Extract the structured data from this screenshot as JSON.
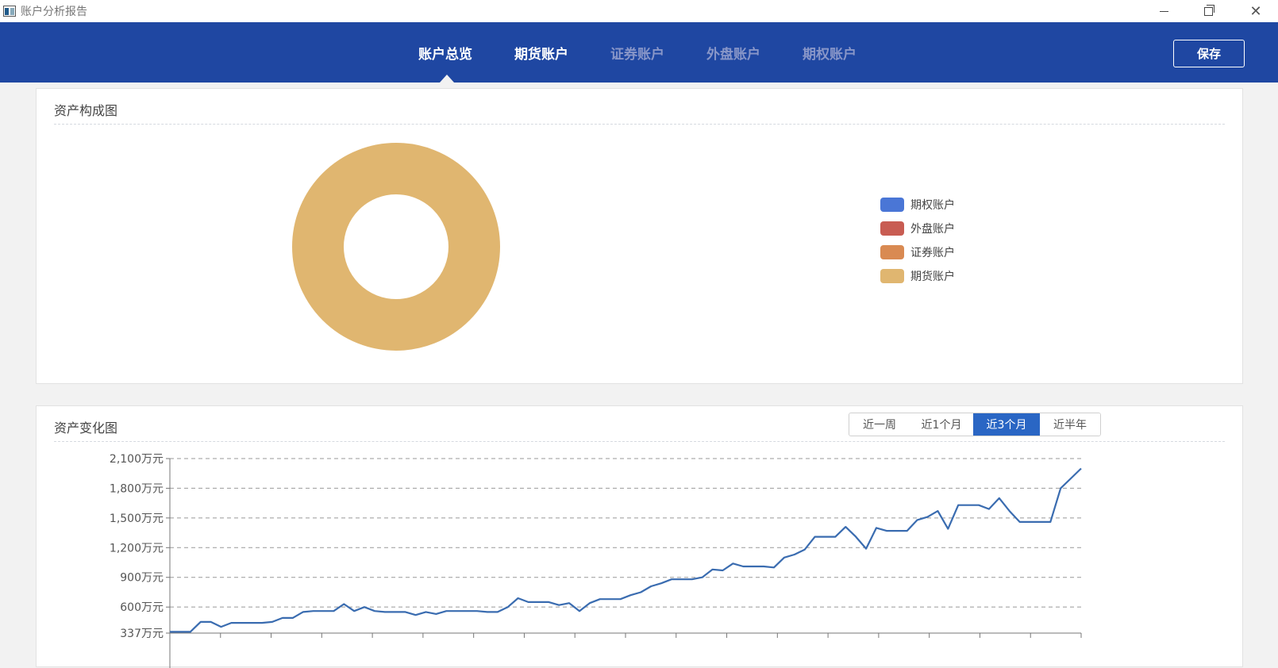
{
  "window": {
    "title": "账户分析报告"
  },
  "nav": {
    "tabs": [
      {
        "label": "账户总览",
        "active": true
      },
      {
        "label": "期货账户",
        "active": false
      },
      {
        "label": "证券账户",
        "active": false
      },
      {
        "label": "外盘账户",
        "active": false
      },
      {
        "label": "期权账户",
        "active": false
      }
    ],
    "save_label": "保存"
  },
  "composition": {
    "title": "资产构成图",
    "legend": [
      {
        "label": "期权账户",
        "color": "#4a76d6"
      },
      {
        "label": "外盘账户",
        "color": "#c85c52"
      },
      {
        "label": "证券账户",
        "color": "#d98a52"
      },
      {
        "label": "期货账户",
        "color": "#e0b670"
      }
    ]
  },
  "change": {
    "title": "资产变化图",
    "ranges": [
      {
        "label": "近一周",
        "active": false
      },
      {
        "label": "近1个月",
        "active": false
      },
      {
        "label": "近3个月",
        "active": true
      },
      {
        "label": "近半年",
        "active": false
      }
    ]
  },
  "chart_data": [
    {
      "type": "pie",
      "title": "资产构成图",
      "categories": [
        "期权账户",
        "外盘账户",
        "证券账户",
        "期货账户"
      ],
      "values": [
        0,
        0,
        0,
        100
      ],
      "colors": [
        "#4a76d6",
        "#c85c52",
        "#d98a52",
        "#e0b670"
      ],
      "legend": "right"
    },
    {
      "type": "line",
      "title": "资产变化图",
      "y_ticks": [
        "337万元",
        "600万元",
        "900万元",
        "1,200万元",
        "1,500万元",
        "1,800万元",
        "2,100万元"
      ],
      "ylim": [
        337,
        2100
      ],
      "grid": true,
      "series": [
        {
          "color": "#3a6cb0",
          "values": [
            350,
            350,
            350,
            450,
            450,
            400,
            440,
            440,
            440,
            440,
            450,
            490,
            490,
            550,
            560,
            560,
            560,
            630,
            560,
            600,
            560,
            550,
            550,
            550,
            520,
            550,
            530,
            560,
            560,
            560,
            560,
            550,
            550,
            600,
            690,
            650,
            650,
            650,
            620,
            640,
            560,
            640,
            680,
            680,
            680,
            720,
            750,
            810,
            840,
            880,
            880,
            880,
            900,
            980,
            970,
            1040,
            1010,
            1010,
            1010,
            1000,
            1100,
            1130,
            1180,
            1310,
            1310,
            1310,
            1410,
            1310,
            1190,
            1400,
            1370,
            1370,
            1370,
            1480,
            1510,
            1570,
            1390,
            1630,
            1630,
            1630,
            1590,
            1700,
            1570,
            1460,
            1460,
            1460,
            1460,
            1800,
            1900,
            2000
          ]
        }
      ]
    }
  ]
}
